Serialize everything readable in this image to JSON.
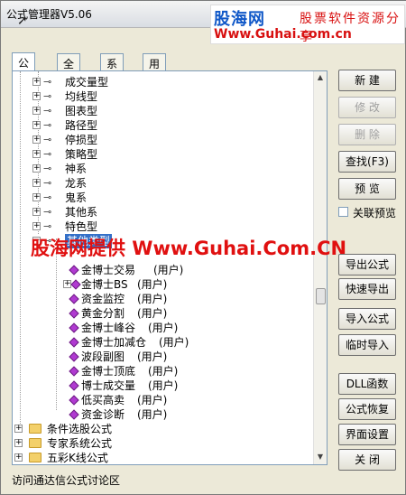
{
  "window": {
    "title": "公式管理器V5.06"
  },
  "brand": {
    "name": "股海网",
    "tagline": "股票软件资源分享",
    "url": "Www.Guhai.com.cn"
  },
  "tabs": [
    "公式组",
    "全部",
    "系统",
    "用户"
  ],
  "tree": {
    "groups": [
      {
        "label": "成交量型"
      },
      {
        "label": "均线型"
      },
      {
        "label": "图表型"
      },
      {
        "label": "路径型"
      },
      {
        "label": "停损型"
      },
      {
        "label": "策略型"
      },
      {
        "label": "神系"
      },
      {
        "label": "龙系"
      },
      {
        "label": "鬼系"
      },
      {
        "label": "其他系"
      },
      {
        "label": "特色型"
      },
      {
        "label": "其他类型"
      }
    ],
    "formulas": [
      {
        "name": "金博士交易",
        "tag": "(用户)"
      },
      {
        "name": "金博士BS",
        "tag": "(用户)"
      },
      {
        "name": "资金监控",
        "tag": "(用户)"
      },
      {
        "name": "黄金分割",
        "tag": "(用户)"
      },
      {
        "name": "金博士峰谷",
        "tag": "(用户)"
      },
      {
        "name": "金博士加减仓",
        "tag": "(用户)"
      },
      {
        "name": "波段副图",
        "tag": "(用户)"
      },
      {
        "name": "金博士顶底",
        "tag": "(用户)"
      },
      {
        "name": "博士成交量",
        "tag": "(用户)"
      },
      {
        "name": "低买高卖",
        "tag": "(用户)"
      },
      {
        "name": "资金诊断",
        "tag": "(用户)"
      }
    ],
    "root_folders": [
      {
        "label": "条件选股公式"
      },
      {
        "label": "专家系统公式"
      },
      {
        "label": "五彩K线公式"
      }
    ]
  },
  "watermark": "股海网提供 Www.Guhai.Com.CN",
  "buttons": {
    "new": "新 建",
    "edit": "修 改",
    "delete": "删 除",
    "find": "查找(F3)",
    "preview": "预 览",
    "export": "导出公式",
    "quick_export": "快速导出",
    "import": "导入公式",
    "temp_import": "临时导入",
    "dll": "DLL函数",
    "restore": "公式恢复",
    "ui_settings": "界面设置",
    "close": "关 闭"
  },
  "linked_preview": {
    "label": "关联预览",
    "checked": false
  },
  "status": "访问通达信公式讨论区"
}
